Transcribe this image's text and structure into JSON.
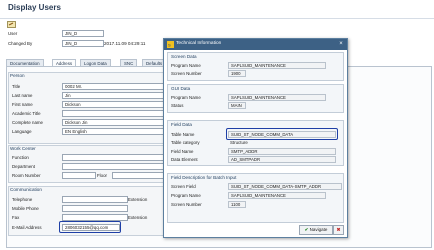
{
  "app": {
    "title": "Display Users"
  },
  "header": {
    "user_label": "User",
    "user_value": "JIN_D",
    "changed_by_label": "Changed By",
    "changed_by_value": "JIN_D",
    "changed_on": "2017.11.09 04:29:11"
  },
  "tabs": [
    "Documentation",
    "Address",
    "Logon Data",
    "SNC",
    "Defaults"
  ],
  "person": {
    "title": "Person",
    "rows": [
      {
        "label": "Title",
        "value": "0002 Mr."
      },
      {
        "label": "Last name",
        "value": "Jin"
      },
      {
        "label": "First name",
        "value": "Dickson"
      },
      {
        "label": "Academic Title",
        "value": ""
      },
      {
        "label": "Complete name",
        "value": "Dickson Jin"
      },
      {
        "label": "Language",
        "value": "EN English"
      }
    ]
  },
  "work_center": {
    "title": "Work Center",
    "function_label": "Function",
    "department_label": "Department",
    "room_label": "Room Number",
    "floor_label": "Floor"
  },
  "communication": {
    "title": "Communication",
    "telephone_label": "Telephone",
    "extension_label": "Extension",
    "mobile_label": "Mobile Phone",
    "fax_label": "Fax",
    "email_label": "E-Mail Address",
    "email_value": "2806032155@qq.com"
  },
  "dialog": {
    "title": "Technical Information",
    "screen_data": {
      "title": "Screen Data",
      "program_label": "Program Name",
      "program_value": "SAPLSUID_MAINTENANCE",
      "screen_label": "Screen Number",
      "screen_value": "1900"
    },
    "gui_data": {
      "title": "GUI Data",
      "program_label": "Program Name",
      "program_value": "SAPLSUID_MAINTENANCE",
      "status_label": "Status",
      "status_value": "MAIN"
    },
    "field_data": {
      "title": "Field Data",
      "table_label": "Table Name",
      "table_value": "SUID_ST_NODE_COMM_DATA",
      "category_label": "Table category",
      "category_value": "Structure",
      "field_label": "Field Name",
      "field_value": "SMTP_ADDR",
      "element_label": "Data Element",
      "element_value": "AD_SMTPADR"
    },
    "batch_input": {
      "title": "Field Description for Batch Input",
      "screen_field_label": "Screen Field",
      "screen_field_value": "SUID_ST_NODE_COMM_DATA-SMTP_ADDR",
      "program_label": "Program Name",
      "program_value": "SAPLSUID_MAINTENANCE",
      "screen_label": "Screen Number",
      "screen_value": "1100"
    },
    "navigate_label": "Navigate"
  }
}
